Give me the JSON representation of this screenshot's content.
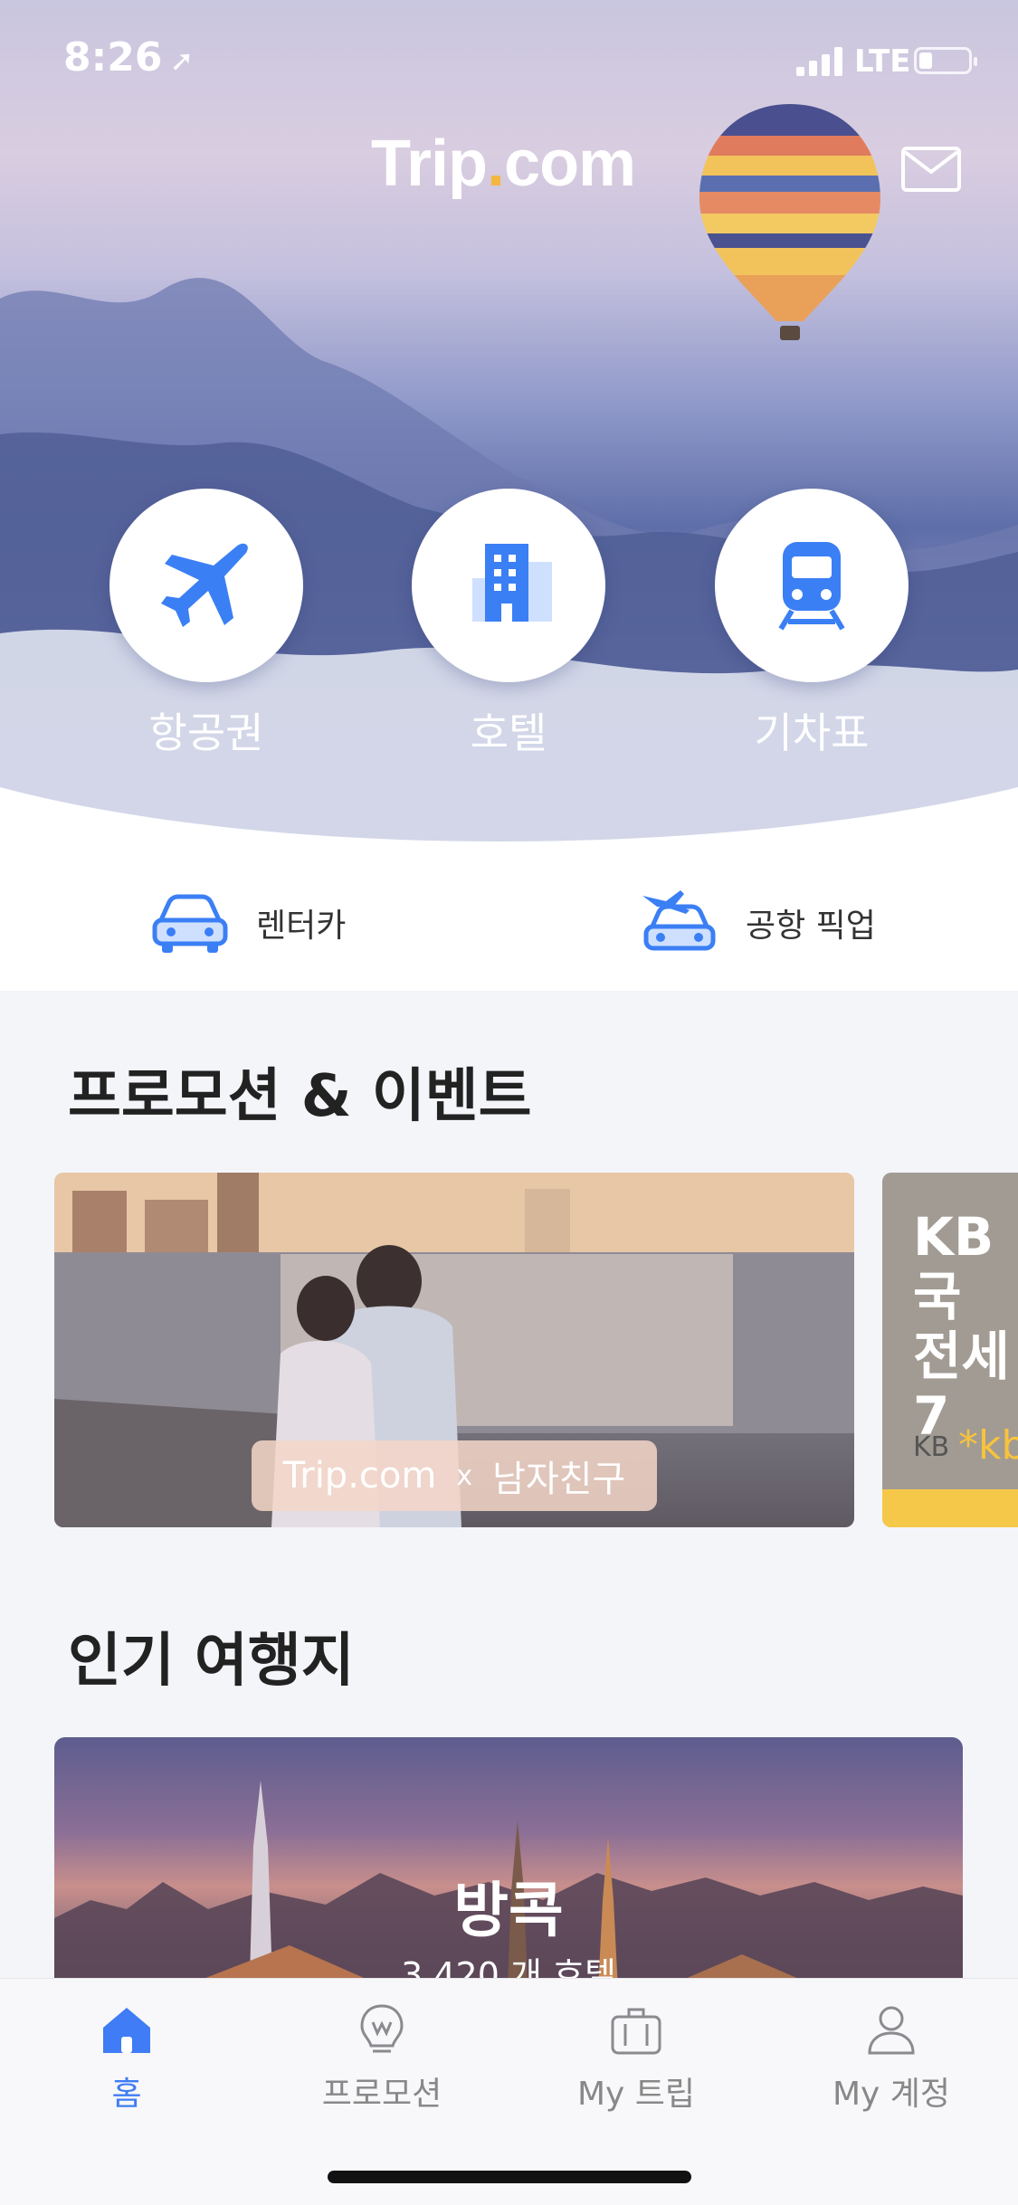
{
  "status_bar": {
    "time": "8:26",
    "network": "LTE",
    "location_icon": "location-arrow-icon"
  },
  "header": {
    "logo_main": "Trip",
    "logo_dot": ".",
    "logo_tld": "com",
    "mail_icon": "mail-icon"
  },
  "services": [
    {
      "label": "항공권",
      "icon": "plane-icon"
    },
    {
      "label": "호텔",
      "icon": "hotel-icon"
    },
    {
      "label": "기차표",
      "icon": "train-icon"
    }
  ],
  "quick_links": [
    {
      "label": "렌터카",
      "icon": "car-icon"
    },
    {
      "label": "공항 픽업",
      "icon": "airport-pickup-icon"
    }
  ],
  "promotions": {
    "title": "프로모션 & 이벤트",
    "cards": [
      {
        "brand": "Trip.com",
        "x": "x",
        "partner": "남자친구"
      },
      {
        "headline_line1": "KB국",
        "headline_line2": "전세7",
        "bank": "KB",
        "bank_mark": "*kb"
      }
    ]
  },
  "popular": {
    "title": "인기 여행지",
    "destinations": [
      {
        "name": "방콕",
        "hotels": "3,420 개 호텔"
      }
    ]
  },
  "tab_bar": {
    "active_color": "#3f7cf5",
    "tabs": [
      {
        "label": "홈",
        "icon": "home-icon",
        "active": true
      },
      {
        "label": "프로모션",
        "icon": "lightbulb-icon",
        "active": false
      },
      {
        "label": "My 트립",
        "icon": "suitcase-icon",
        "active": false
      },
      {
        "label": "My 계정",
        "icon": "user-icon",
        "active": false
      }
    ]
  }
}
